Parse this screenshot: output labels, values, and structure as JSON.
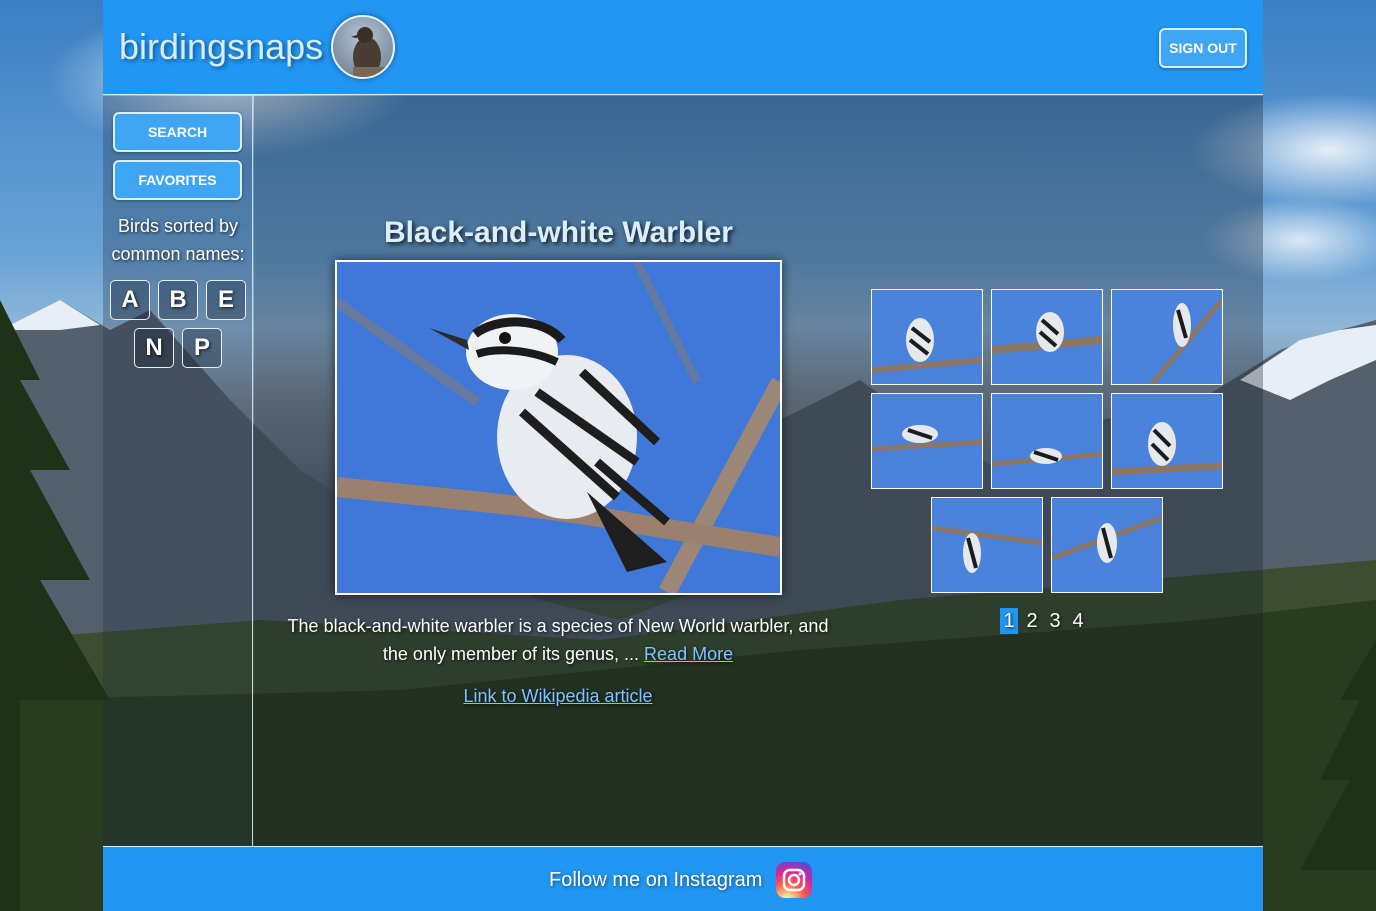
{
  "header": {
    "logo_text": "birdingsnaps",
    "sign_out_label": "SIGN OUT"
  },
  "sidebar": {
    "search_label": "SEARCH",
    "favorites_label": "FAVORITES",
    "sorted_text": "Birds sorted by common names:",
    "letters": [
      "A",
      "B",
      "E",
      "N",
      "P"
    ]
  },
  "bird": {
    "name": "Black-and-white Warbler",
    "description": "The black-and-white warbler is a species of New World warbler, and the only member of its genus, ...",
    "read_more": "Read More",
    "wiki_link": "Link to Wikipedia article"
  },
  "gallery": {
    "thumbnail_count": 8,
    "pages": [
      "1",
      "2",
      "3",
      "4"
    ],
    "current_page": "1"
  },
  "footer": {
    "text": "Follow me on Instagram",
    "icon": "instagram-icon"
  },
  "colors": {
    "primary": "#2196f3",
    "button": "#3fa6f5",
    "link": "#7fc3ff"
  }
}
